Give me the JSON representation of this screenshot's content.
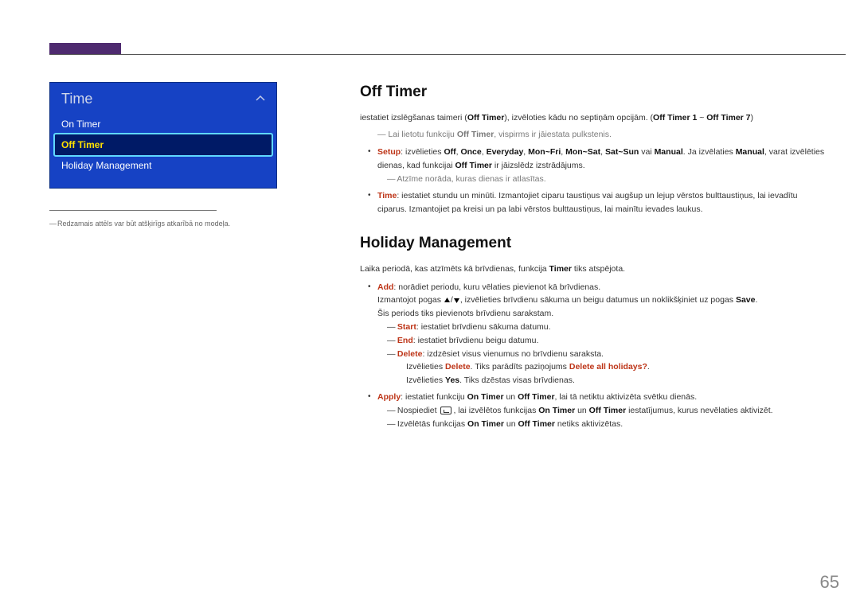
{
  "page_number": "65",
  "menu": {
    "title": "Time",
    "items": [
      "On Timer",
      "Off Timer",
      "Holiday Management"
    ],
    "selected_index": 1
  },
  "side_note": "Redzamais attēls var būt atšķirīgs atkarībā no modeļa.",
  "section_off_timer": {
    "heading": "Off Timer",
    "intro_a": "iestatiet izslēgšanas taimeri (",
    "intro_a_b": "Off Timer",
    "intro_b": "), izvēloties kādu no septiņām opcijām. (",
    "intro_c_b": "Off Timer 1",
    "intro_tilde": " ~ ",
    "intro_d_b": "Off Timer 7",
    "intro_close": ")",
    "note1_a": "Lai lietotu funkciju ",
    "note1_b": "Off Timer",
    "note1_c": ", vispirms ir jāiestata pulkstenis.",
    "setup_label": "Setup",
    "setup_a": ": izvēlieties ",
    "setup_opts": [
      "Off",
      "Once",
      "Everyday",
      "Mon~Fri",
      "Mon~Sat",
      "Sat~Sun"
    ],
    "setup_or": " vai ",
    "setup_manual": "Manual",
    "setup_b": ". Ja izvēlaties ",
    "setup_c": ", varat izvēlēties dienas, kad funkcijai ",
    "setup_off_timer": "Off Timer",
    "setup_d": " ir jāizslēdz izstrādājums.",
    "note2": "Atzīme norāda, kuras dienas ir atlasītas.",
    "time_label": "Time",
    "time_text": ": iestatiet stundu un minūti. Izmantojiet ciparu taustiņus vai augšup un lejup vērstos bulttaustiņus, lai ievadītu ciparus. Izmantojiet pa kreisi un pa labi vērstos bulttaustiņus, lai mainītu ievades laukus."
  },
  "section_hm": {
    "heading": "Holiday Management",
    "intro_a": "Laika periodā, kas atzīmēts kā brīvdienas, funkcija ",
    "intro_b": "Timer",
    "intro_c": " tiks atspējota.",
    "add_label": "Add",
    "add_text": ": norādiet periodu, kuru vēlaties pievienot kā brīvdienas.",
    "add_text2_a": "Izmantojot pogas ",
    "add_text2_b": ", izvēlieties brīvdienu sākuma un beigu datumus un noklikšķiniet uz pogas ",
    "add_text2_save": "Save",
    "add_text2_c": ".",
    "add_text3": "Šis periods tiks pievienots brīvdienu sarakstam.",
    "start_label": "Start",
    "start_text": ": iestatiet brīvdienu sākuma datumu.",
    "end_label": "End",
    "end_text": ": iestatiet brīvdienu beigu datumu.",
    "delete_label": "Delete",
    "delete_text": ": izdzēsiet visus vienumus no brīvdienu saraksta.",
    "delete_sub1_a": "Izvēlieties ",
    "delete_sub1_b": "Delete",
    "delete_sub1_c": ". Tiks parādīts paziņojums ",
    "delete_sub1_d": "Delete all holidays?",
    "delete_sub1_e": ".",
    "delete_sub2_a": "Izvēlieties ",
    "delete_sub2_b": "Yes",
    "delete_sub2_c": ". Tiks dzēstas visas brīvdienas.",
    "apply_label": "Apply",
    "apply_a": ": iestatiet funkciju ",
    "apply_on": "On Timer",
    "apply_b": " un ",
    "apply_off": "Off Timer",
    "apply_c": ", lai tā netiktu aktivizēta svētku dienās.",
    "apply_sub1_a": "Nospiediet ",
    "apply_sub1_b": ", lai izvēlētos funkcijas ",
    "apply_sub1_c": " iestatījumus, kurus nevēlaties aktivizēt.",
    "apply_sub2_a": "Izvēlētās funkcijas ",
    "apply_sub2_b": " netiks aktivizētas."
  }
}
